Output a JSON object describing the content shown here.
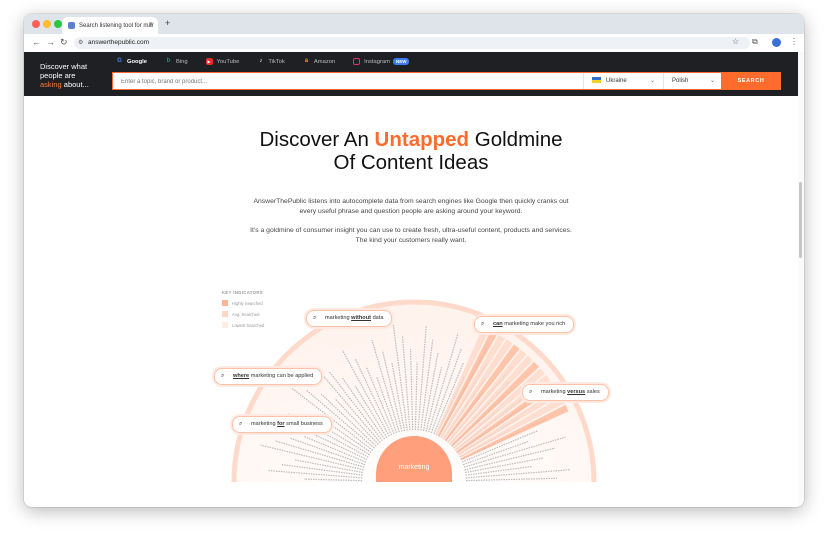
{
  "browser": {
    "tab_title": "Search listening tool for mar",
    "tab_close": "×",
    "new_tab": "+",
    "url": "answerthepublic.com",
    "nav": {
      "back": "←",
      "forward": "→",
      "reload": "↻"
    }
  },
  "header": {
    "tagline_1": "Discover what",
    "tagline_2": "people are",
    "tagline_hl": "asking",
    "tagline_3": " about...",
    "engines": [
      {
        "label": "Google",
        "icon": "google-icon"
      },
      {
        "label": "Bing",
        "icon": "bing-icon"
      },
      {
        "label": "YouTube",
        "icon": "youtube-icon"
      },
      {
        "label": "TikTok",
        "icon": "tiktok-icon"
      },
      {
        "label": "Amazon",
        "icon": "amazon-icon"
      },
      {
        "label": "Instagram",
        "icon": "instagram-icon",
        "badge": "NEW"
      }
    ],
    "search_placeholder": "Enter a topic, brand or product...",
    "country": "Ukraine",
    "language": "Polish",
    "search_button": "SEARCH"
  },
  "hero": {
    "title_1": "Discover An ",
    "title_hl": "Untapped",
    "title_2": " Goldmine",
    "title_3": "Of Content Ideas",
    "para_1a": "AnswerThePublic listens into autocomplete data from search engines like Google then quickly cranks out",
    "para_1b": "every useful phrase and question people are asking around your keyword.",
    "para_2a": "It's a goldmine of consumer insight you can use to create fresh, ultra-useful content, products and services.",
    "para_2b": "The kind your customers really want."
  },
  "visual": {
    "legend_title": "KEY INDICATORS",
    "legend": [
      "Highly Searched",
      "Avg. Searched",
      "Lowest Searched"
    ],
    "hub": "marketing",
    "pills": {
      "p1_pre": "marketing ",
      "p1_u": "without",
      "p1_post": " data",
      "p2_u": "can",
      "p2_post": " marketing make you rich",
      "p3_u": "where",
      "p3_post": " marketing can be applied",
      "p4_pre": "marketing ",
      "p4_u": "versus",
      "p4_post": " sales",
      "p5_pre": "marketing ",
      "p5_u": "for",
      "p5_post": " small business"
    }
  },
  "colors": {
    "accent": "#ff6b2c",
    "header_bg": "#1f2023"
  }
}
